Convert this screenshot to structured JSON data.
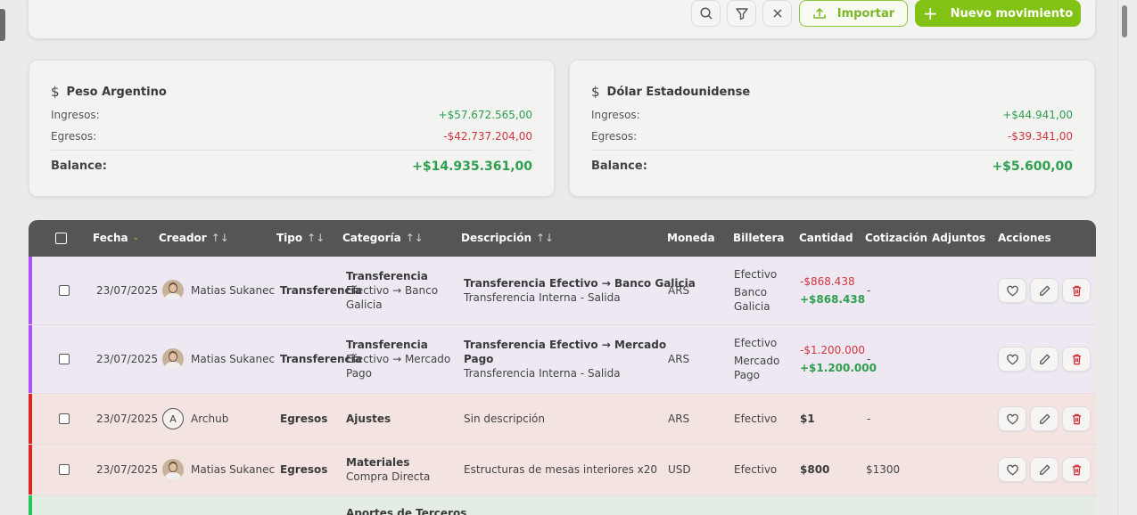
{
  "toolbar": {
    "import_label": "Importar",
    "new_label": "Nuevo movimiento",
    "plus_glyph": "+"
  },
  "summaries": [
    {
      "currency_symbol": "$",
      "title": "Peso Argentino",
      "ingresos_label": "Ingresos:",
      "ingresos": "+$57.672.565,00",
      "egresos_label": "Egresos:",
      "egresos": "-$42.737.204,00",
      "balance_label": "Balance:",
      "balance": "+$14.935.361,00"
    },
    {
      "currency_symbol": "$",
      "title": "Dólar Estadounidense",
      "ingresos_label": "Ingresos:",
      "ingresos": "+$44.941,00",
      "egresos_label": "Egresos:",
      "egresos": "-$39.341,00",
      "balance_label": "Balance:",
      "balance": "+$5.600,00"
    }
  ],
  "table": {
    "headers": {
      "fecha": "Fecha",
      "creador": "Creador",
      "tipo": "Tipo",
      "categoria": "Categoría",
      "descripcion": "Descripción",
      "moneda": "Moneda",
      "billetera": "Billetera",
      "cantidad": "Cantidad",
      "cotizacion": "Cotización",
      "adjuntos": "Adjuntos",
      "acciones": "Acciones"
    },
    "sort_glyph": "↑↓",
    "active_sort_glyph": "⌄",
    "rows": [
      {
        "fecha": "23/07/2025",
        "creador": "Matias Sukanec",
        "tipo": "Transferencia",
        "categoria": "Transferencia",
        "categoria_sub_1": "Efectivo → Banco",
        "categoria_sub_2": "Galicia",
        "descripcion": "Transferencia Efectivo → Banco Galicia",
        "descripcion_sub": "Transferencia Interna - Salida",
        "moneda": "ARS",
        "billetera_1": "Efectivo",
        "billetera_2": "Banco",
        "billetera_3": "Galicia",
        "cantidad_neg": "-$868.438",
        "cantidad_pos": "+$868.438",
        "cotizacion": "-"
      },
      {
        "fecha": "23/07/2025",
        "creador": "Matias Sukanec",
        "tipo": "Transferencia",
        "categoria": "Transferencia",
        "categoria_sub_1": "Efectivo → Mercado",
        "categoria_sub_2": "Pago",
        "descripcion_1": "Transferencia Efectivo → Mercado",
        "descripcion_2": "Pago",
        "descripcion_sub": "Transferencia Interna - Salida",
        "moneda": "ARS",
        "billetera_1": "Efectivo",
        "billetera_2": "Mercado",
        "billetera_3": "Pago",
        "cantidad_neg": "-$1.200.000",
        "cantidad_pos": "+$1.200.000",
        "cotizacion": "-"
      },
      {
        "fecha": "23/07/2025",
        "creador_initial": "A",
        "creador": "Archub",
        "tipo": "Egresos",
        "categoria": "Ajustes",
        "descripcion": "Sin descripción",
        "moneda": "ARS",
        "billetera": "Efectivo",
        "cantidad": "$1",
        "cotizacion": "-"
      },
      {
        "fecha": "23/07/2025",
        "creador": "Matias Sukanec",
        "tipo": "Egresos",
        "categoria": "Materiales",
        "categoria_sub": "Compra Directa",
        "descripcion": "Estructuras de mesas interiores x20",
        "moneda": "USD",
        "billetera": "Efectivo",
        "cantidad": "$800",
        "cotizacion": "$1300"
      },
      {
        "categoria": "Aportes de Terceros"
      }
    ]
  },
  "colors": {
    "accent_green": "#82c214",
    "transfer_bar": "#a855f7",
    "egreso_bar": "#dc2626",
    "ingreso_bar": "#22c55e",
    "positive": "#2e9e4f",
    "negative": "#d1343f"
  }
}
